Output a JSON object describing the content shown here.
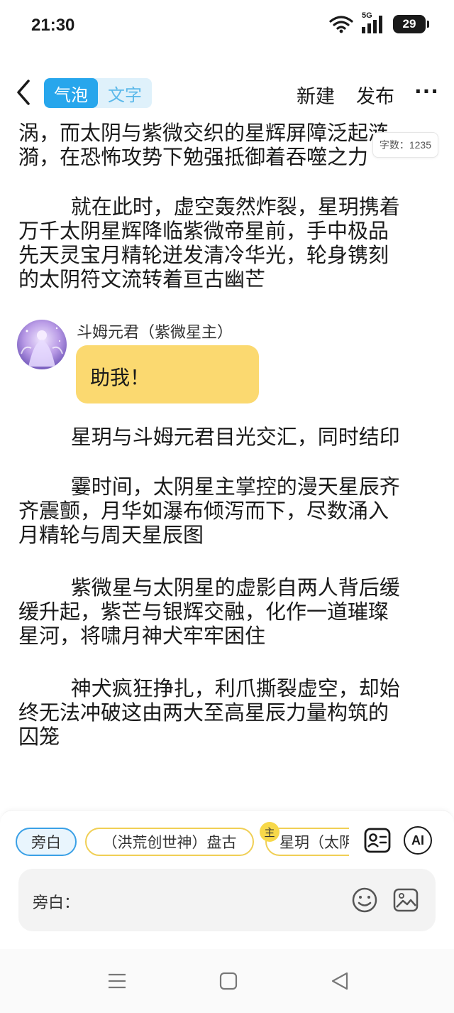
{
  "status_bar": {
    "time": "21:30",
    "network": "5G",
    "battery": "29",
    "icons": [
      "wifi-icon",
      "signal-icon",
      "battery-icon"
    ]
  },
  "header": {
    "mode_tabs": [
      {
        "label": "气泡",
        "active": true
      },
      {
        "label": "文字",
        "active": false
      }
    ],
    "new_label": "新建",
    "publish_label": "发布",
    "more_label": "···"
  },
  "content": {
    "word_count": "字数：1235",
    "paragraphs_top": [
      "涡，而太阴与紫微交织的星辉屏障泛起涟\n漪，在恐怖攻势下勉强抵御着吞噬之力",
      "        就在此时，虚空轰然炸裂，星玥携着\n万千太阴星辉降临紫微帝星前，手中极品\n先天灵宝月精轮迸发清冷华光，轮身镌刻\n的太阴符文流转着亘古幽芒"
    ],
    "dialogue": {
      "speaker": "斗姆元君（紫微星主）",
      "text": "助我！"
    },
    "paragraphs_bottom": [
      "        星玥与斗姆元君目光交汇，同时结印",
      "        霎时间，太阴星主掌控的漫天星辰齐\n齐震颤，月华如瀑布倾泻而下，尽数涌入\n月精轮与周天星辰图",
      "        紫微星与太阴星的虚影自两人背后缓\n缓升起，紫芒与银辉交融，化作一道璀璨\n星河，将啸月神犬牢牢困住",
      "        神犬疯狂挣扎，利爪撕裂虚空，却始\n终无法冲破这由两大至高星辰力量构筑的\n囚笼"
    ]
  },
  "composer": {
    "chips": [
      "旁白",
      "（洪荒创世神）盘古",
      "星玥（太阴"
    ],
    "main_badge": "主",
    "ai_label": "AI",
    "input_label": "旁白："
  },
  "colors": {
    "accent_blue": "#27a6ec",
    "bubble_yellow": "#fbd970",
    "chip_yellow_border": "#f0cf55"
  }
}
